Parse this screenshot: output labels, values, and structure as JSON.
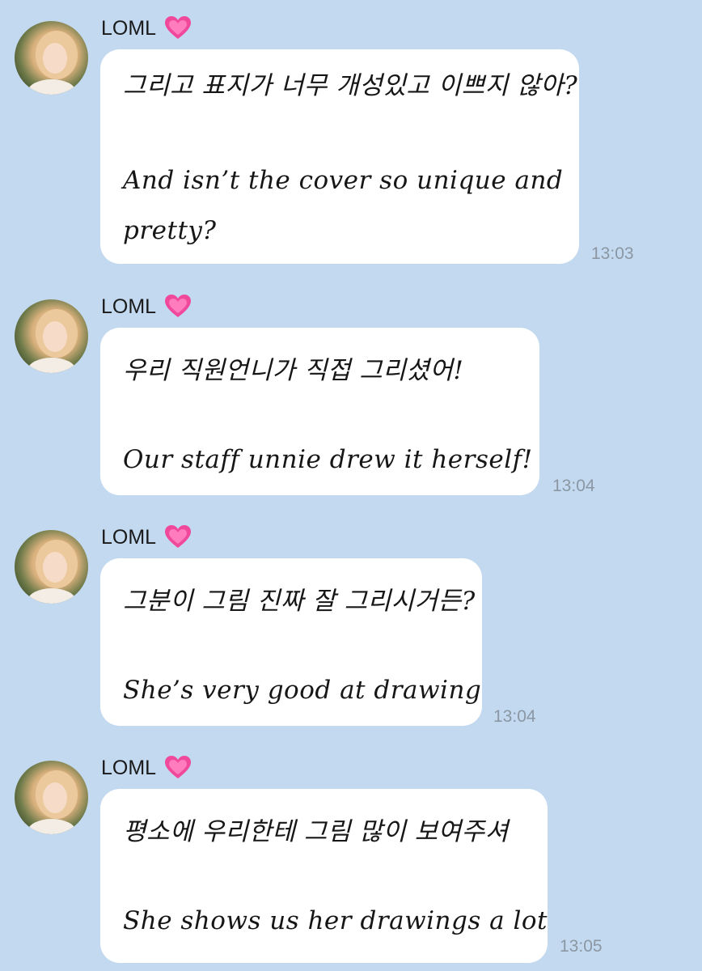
{
  "messages": [
    {
      "sender": "LOML",
      "korean": "그리고 표지가 너무 개성있고 이쁘지 않아?",
      "english_line1": "And isn’t the cover so unique and",
      "english_line2": "pretty?",
      "time": "13:03"
    },
    {
      "sender": "LOML",
      "korean": "우리 직원언니가 직접 그리셨어!",
      "english_line1": "Our staff unnie drew it herself!",
      "time": "13:04"
    },
    {
      "sender": "LOML",
      "korean": "그분이 그림 진짜 잘 그리시거든?",
      "english_line1": "She’s very good at drawing",
      "time": "13:04"
    },
    {
      "sender": "LOML",
      "korean": "평소에 우리한테 그림 많이 보여주셔",
      "english_line1": "She shows us her drawings a lot",
      "time": "13:05"
    }
  ],
  "icons": {
    "sender_badge": "pink-heart-icon",
    "avatar": "profile-avatar"
  },
  "colors": {
    "background": "#c3d9f0",
    "bubble": "#ffffff",
    "timestamp": "#8b97a3",
    "heart": "#f0489a"
  }
}
